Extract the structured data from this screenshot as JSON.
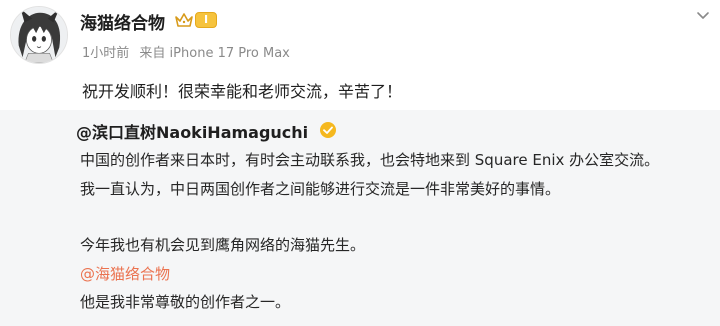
{
  "post": {
    "author": {
      "name": "海猫络合物",
      "level": "I"
    },
    "meta": {
      "time": "1小时前",
      "source": "来自 iPhone 17 Pro Max"
    },
    "text": "祝开发顺利！很荣幸能和老师交流，辛苦了！"
  },
  "repost": {
    "author": "@滨口直树NaokiHamaguchi",
    "lines": [
      "中国的创作者来日本时，有时会主动联系我，也会特地来到 Square Enix 办公室交流。",
      "我一直认为，中日两国创作者之间能够进行交流是一件非常美好的事情。",
      "今年我也有机会见到鹰角网络的海猫先生。",
      "@海猫络合物",
      "他是我非常尊敬的创作者之一。"
    ]
  },
  "colors": {
    "mention": "#eb7350",
    "badge": "#f6c33d",
    "verified": "#f5b81f",
    "repost_bg": "#f5f6f7"
  },
  "icons": [
    "avatar",
    "crown-icon",
    "level-badge",
    "more-icon",
    "verified-icon"
  ]
}
